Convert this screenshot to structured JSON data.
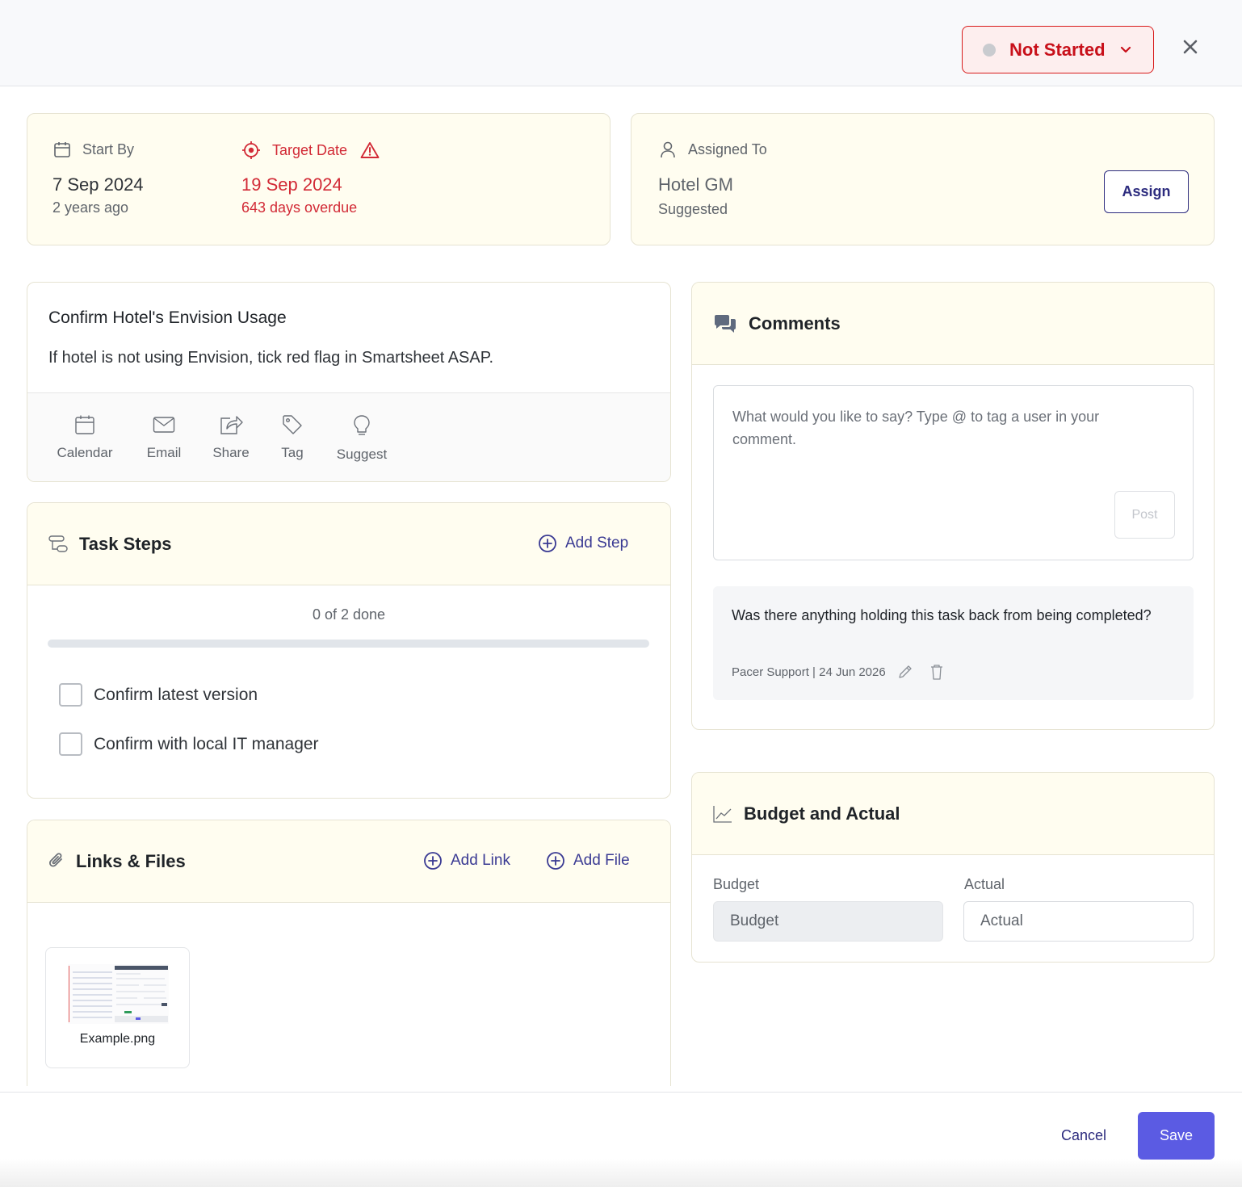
{
  "header": {
    "status_label": "Not Started",
    "status_color": "#c8101a",
    "close_icon": "close-icon"
  },
  "dates": {
    "start_label": "Start By",
    "start_value": "7 Sep 2024",
    "start_sub": "2 years ago",
    "target_label": "Target Date",
    "target_value": "19 Sep 2024",
    "target_sub": "643 days overdue",
    "overdue_color": "#d22a36"
  },
  "assignment": {
    "label": "Assigned To",
    "value": "Hotel GM",
    "sub": "Suggested",
    "assign_button": "Assign"
  },
  "task": {
    "title": "Confirm Hotel's Envision Usage",
    "description": "If hotel is not using Envision, tick red flag in Smartsheet ASAP.",
    "actions": [
      {
        "label": "Calendar",
        "icon": "calendar-icon"
      },
      {
        "label": "Email",
        "icon": "email-icon"
      },
      {
        "label": "Share",
        "icon": "share-icon"
      },
      {
        "label": "Tag",
        "icon": "tag-icon"
      },
      {
        "label": "Suggest",
        "icon": "lightbulb-icon"
      }
    ]
  },
  "steps": {
    "title": "Task Steps",
    "add_label": "Add Step",
    "progress_text": "0 of 2 done",
    "progress_fraction": 0,
    "items": [
      {
        "label": "Confirm latest version",
        "checked": false
      },
      {
        "label": "Confirm with local IT manager",
        "checked": false
      }
    ]
  },
  "links_files": {
    "title": "Links & Files",
    "add_link_label": "Add Link",
    "add_file_label": "Add File",
    "files": [
      {
        "name": "Example.png"
      }
    ]
  },
  "comments": {
    "title": "Comments",
    "placeholder": "What would you like to say? Type @ to tag a user in your comment.",
    "post_label": "Post",
    "items": [
      {
        "text": "Was there anything holding this task back from being completed?",
        "meta": "Pacer Support | 24 Jun 2026"
      }
    ]
  },
  "budget": {
    "title": "Budget and Actual",
    "budget_label": "Budget",
    "budget_placeholder": "Budget",
    "actual_label": "Actual",
    "actual_placeholder": "Actual"
  },
  "footer": {
    "cancel_label": "Cancel",
    "save_label": "Save",
    "accent": "#5b5be3"
  }
}
